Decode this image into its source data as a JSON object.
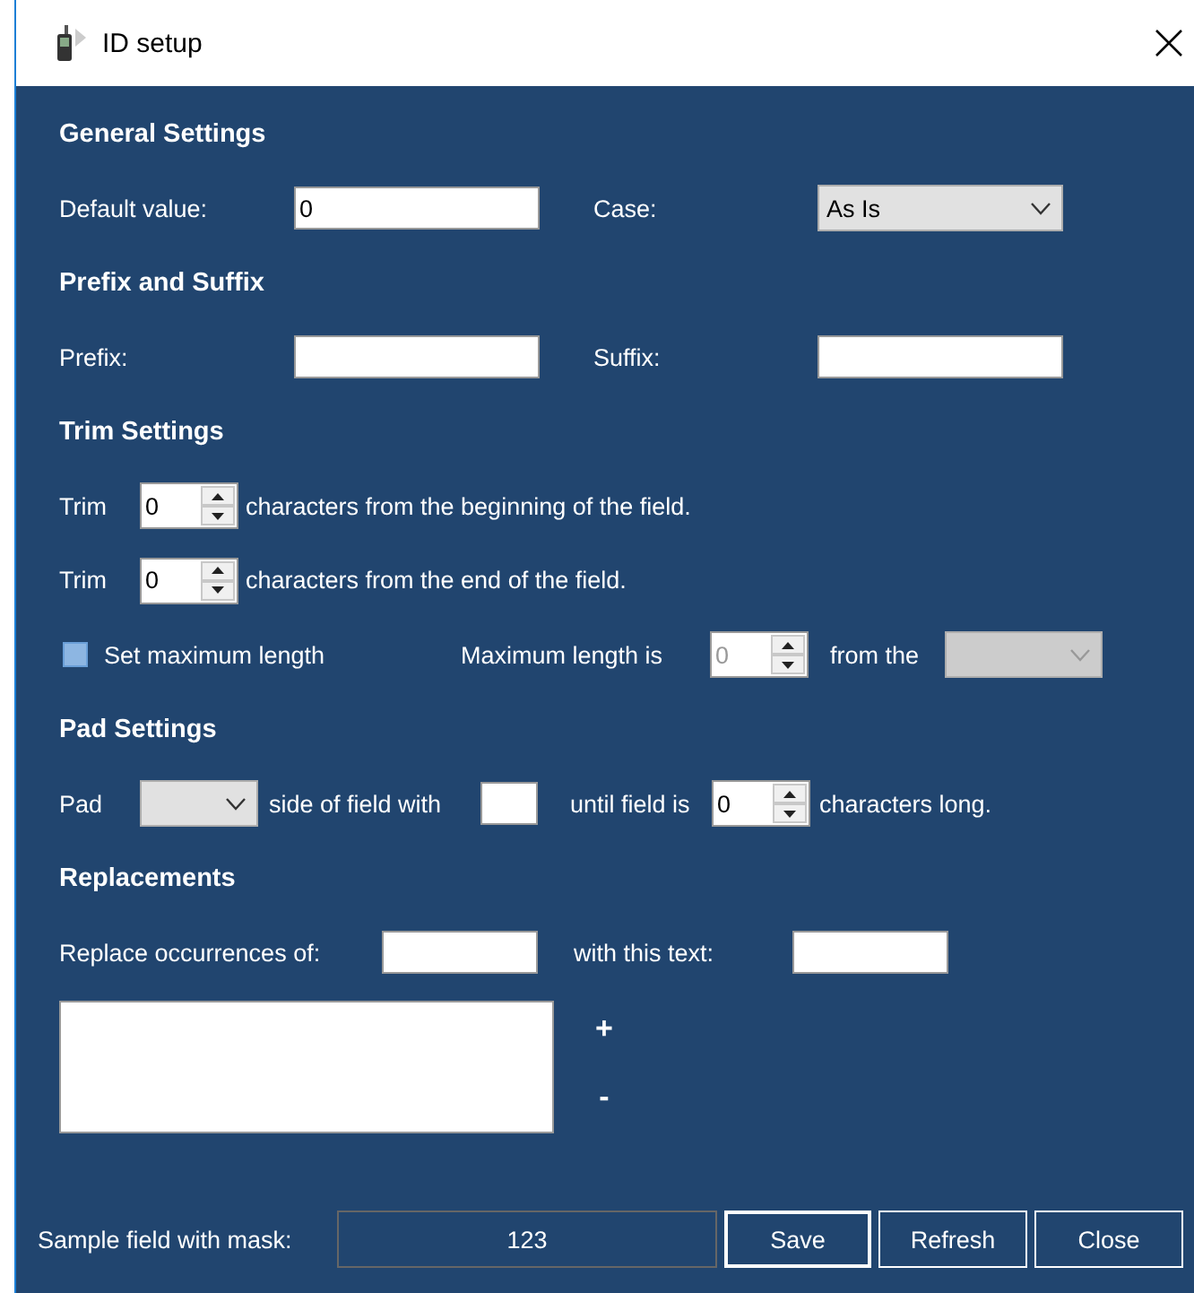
{
  "window": {
    "title": "ID setup"
  },
  "general": {
    "heading": "General Settings",
    "default_value": {
      "label": "Default value:",
      "value": "0"
    },
    "case": {
      "label": "Case:",
      "value": "As Is"
    }
  },
  "prefix_suffix": {
    "heading": "Prefix and Suffix",
    "prefix": {
      "label": "Prefix:"
    },
    "suffix": {
      "label": "Suffix:"
    }
  },
  "trim": {
    "heading": "Trim Settings",
    "rows": [
      {
        "label": "Trim",
        "value": "0",
        "text": "characters from the beginning of the field."
      },
      {
        "label": "Trim",
        "value": "0",
        "text": "characters from the end of the field."
      }
    ],
    "max_length": {
      "checkbox_label": "Set maximum length",
      "checked": false,
      "label": "Maximum length is",
      "value": "0",
      "from_label": "from the",
      "disabled": true
    }
  },
  "pad": {
    "heading": "Pad Settings",
    "label": "Pad",
    "side_text": "side of field with",
    "until_text": "until field is",
    "value": "0",
    "end_text": "characters long."
  },
  "replacements": {
    "heading": "Replacements",
    "find_label": "Replace occurrences of:",
    "replace_label": "with this text:",
    "add": "+",
    "remove": "-"
  },
  "footer": {
    "sample_label": "Sample field with mask:",
    "sample_value": "123",
    "buttons": [
      {
        "label": "Save",
        "default": true
      },
      {
        "label": "Refresh",
        "default": false
      },
      {
        "label": "Close",
        "default": false
      }
    ]
  }
}
